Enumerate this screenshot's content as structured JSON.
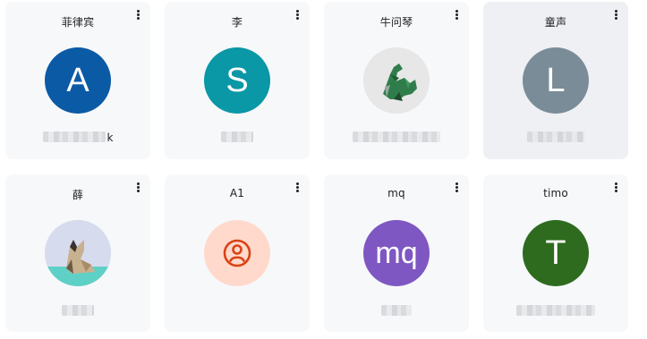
{
  "cards": [
    {
      "name": "菲律宾",
      "avatar": {
        "type": "letter",
        "letter": "A",
        "color": "#0b5aa5"
      },
      "subtitle": "k"
    },
    {
      "name": "李",
      "avatar": {
        "type": "letter",
        "letter": "S",
        "color": "#0a97a6"
      },
      "subtitle": ""
    },
    {
      "name": "牛问琴",
      "avatar": {
        "type": "image",
        "icon": "origami-dinosaur-image"
      },
      "subtitle": ""
    },
    {
      "name": "童声",
      "avatar": {
        "type": "letter",
        "letter": "L",
        "color": "#7a8c98"
      },
      "subtitle": ""
    },
    {
      "name": "薛",
      "avatar": {
        "type": "image",
        "icon": "origami-cat-image"
      },
      "subtitle": ""
    },
    {
      "name": "A1",
      "avatar": {
        "type": "icon",
        "icon": "user-circle-icon",
        "color": "#ffd9cc",
        "fg": "#d84315"
      },
      "subtitle": ""
    },
    {
      "name": "mq",
      "avatar": {
        "type": "letter",
        "letter": "mq",
        "color": "#7e57c2"
      },
      "subtitle": ""
    },
    {
      "name": "timo",
      "avatar": {
        "type": "letter",
        "letter": "T",
        "color": "#2e6b1f"
      },
      "subtitle": ""
    }
  ],
  "menu_icon": "more-vert-icon"
}
